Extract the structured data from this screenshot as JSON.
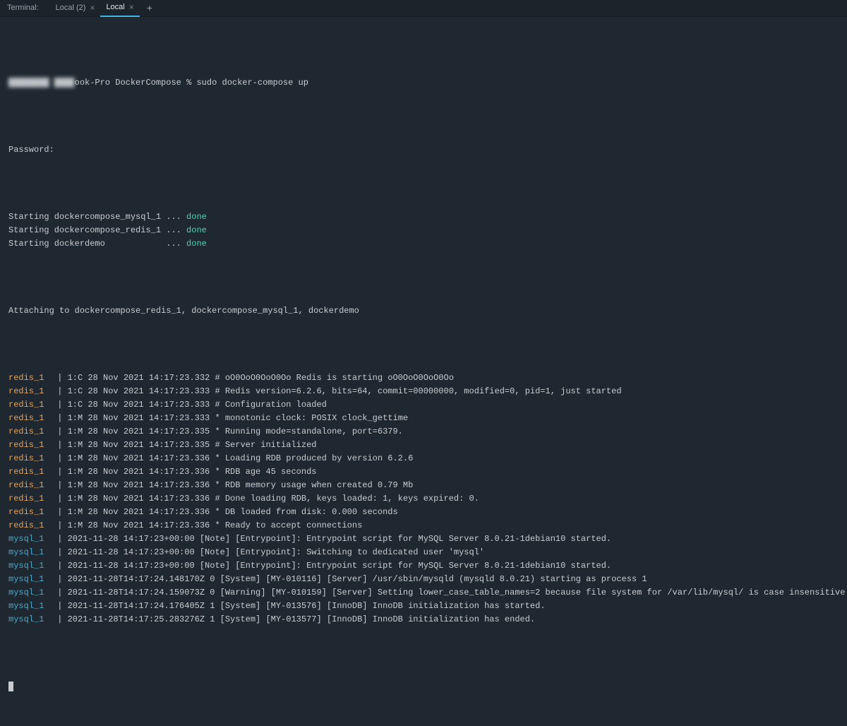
{
  "tabbar": {
    "label": "Terminal:",
    "tabs": [
      {
        "name": "Local (2)",
        "active": false
      },
      {
        "name": "Local",
        "active": true
      }
    ],
    "close_glyph": "×",
    "add_glyph": "+"
  },
  "prompt": {
    "obscured_prefix": "████████ ████",
    "visible_host_fragment": "ook-Pro",
    "cwd": "DockerCompose",
    "prompt_char": "%",
    "command": "sudo docker-compose up"
  },
  "password_label": "Password:",
  "starting": [
    {
      "service": "dockercompose_mysql_1",
      "dots": "...",
      "state": "done"
    },
    {
      "service": "dockercompose_redis_1",
      "dots": "...",
      "state": "done"
    },
    {
      "service": "dockerdemo",
      "dots": "...",
      "state": "done"
    }
  ],
  "attaching_line": "Attaching to dockercompose_redis_1, dockercompose_mysql_1, dockerdemo",
  "log_lines": [
    {
      "label": "redis_1",
      "text": "1:C 28 Nov 2021 14:17:23.332 # oO0OoO0OoO0Oo Redis is starting oO0OoO0OoO0Oo"
    },
    {
      "label": "redis_1",
      "text": "1:C 28 Nov 2021 14:17:23.333 # Redis version=6.2.6, bits=64, commit=00000000, modified=0, pid=1, just started"
    },
    {
      "label": "redis_1",
      "text": "1:C 28 Nov 2021 14:17:23.333 # Configuration loaded"
    },
    {
      "label": "redis_1",
      "text": "1:M 28 Nov 2021 14:17:23.333 * monotonic clock: POSIX clock_gettime"
    },
    {
      "label": "redis_1",
      "text": "1:M 28 Nov 2021 14:17:23.335 * Running mode=standalone, port=6379."
    },
    {
      "label": "redis_1",
      "text": "1:M 28 Nov 2021 14:17:23.335 # Server initialized"
    },
    {
      "label": "redis_1",
      "text": "1:M 28 Nov 2021 14:17:23.336 * Loading RDB produced by version 6.2.6"
    },
    {
      "label": "redis_1",
      "text": "1:M 28 Nov 2021 14:17:23.336 * RDB age 45 seconds"
    },
    {
      "label": "redis_1",
      "text": "1:M 28 Nov 2021 14:17:23.336 * RDB memory usage when created 0.79 Mb"
    },
    {
      "label": "redis_1",
      "text": "1:M 28 Nov 2021 14:17:23.336 # Done loading RDB, keys loaded: 1, keys expired: 0."
    },
    {
      "label": "redis_1",
      "text": "1:M 28 Nov 2021 14:17:23.336 * DB loaded from disk: 0.000 seconds"
    },
    {
      "label": "redis_1",
      "text": "1:M 28 Nov 2021 14:17:23.336 * Ready to accept connections"
    },
    {
      "label": "mysql_1",
      "text": "2021-11-28 14:17:23+00:00 [Note] [Entrypoint]: Entrypoint script for MySQL Server 8.0.21-1debian10 started."
    },
    {
      "label": "mysql_1",
      "text": "2021-11-28 14:17:23+00:00 [Note] [Entrypoint]: Switching to dedicated user 'mysql'"
    },
    {
      "label": "mysql_1",
      "text": "2021-11-28 14:17:23+00:00 [Note] [Entrypoint]: Entrypoint script for MySQL Server 8.0.21-1debian10 started."
    },
    {
      "label": "mysql_1",
      "text": "2021-11-28T14:17:24.148170Z 0 [System] [MY-010116] [Server] /usr/sbin/mysqld (mysqld 8.0.21) starting as process 1"
    },
    {
      "label": "mysql_1",
      "text": "2021-11-28T14:17:24.159073Z 0 [Warning] [MY-010159] [Server] Setting lower_case_table_names=2 because file system for /var/lib/mysql/ is case insensitive"
    },
    {
      "label": "mysql_1",
      "text": "2021-11-28T14:17:24.176405Z 1 [System] [MY-013576] [InnoDB] InnoDB initialization has started."
    },
    {
      "label": "mysql_1",
      "text": "2021-11-28T14:17:25.283276Z 1 [System] [MY-013577] [InnoDB] InnoDB initialization has ended."
    }
  ],
  "separator": " | "
}
